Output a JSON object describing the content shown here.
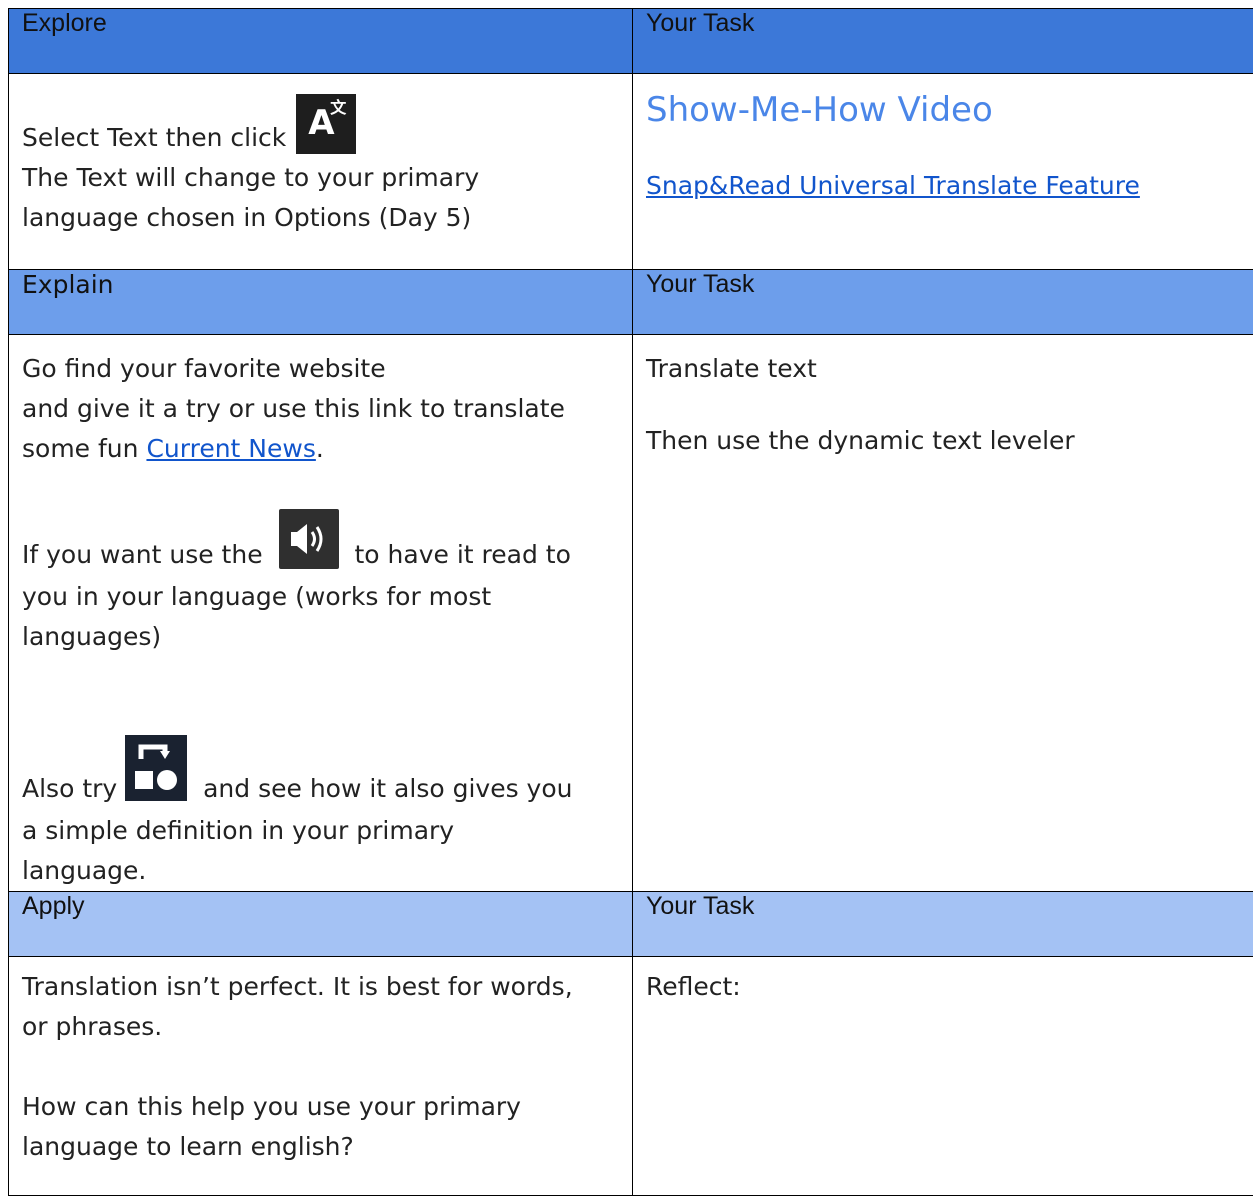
{
  "explore": {
    "header_left": "Explore",
    "header_right": "Your Task",
    "left_line1": "Select Text then click",
    "left_line2": "The Text will change to your primary",
    "left_line3": "language chosen in Options (Day 5)",
    "video_title": "Show-Me-How Video",
    "video_link": "Snap&Read Universal Translate Feature",
    "icon_name": "translate-icon"
  },
  "explain": {
    "header_left": "Explain",
    "header_right": "Your Task",
    "line1": "Go find your favorite website",
    "line2": "and give it a try or use this link to translate",
    "line3_prefix": "some fun ",
    "news_link": "Current News",
    "line3_suffix": ".",
    "speaker_prefix": "If you want use the",
    "speaker_suffix": "to have it read to",
    "line5": "you in your language (works for most",
    "line6": "languages)",
    "also_prefix": "Also try",
    "also_suffix": "and see how it also gives you",
    "line8": "a simple definition in your primary",
    "line9": "language.",
    "task1": "Translate text",
    "task2": "Then use the dynamic text leveler",
    "speaker_icon_name": "speaker-icon",
    "define_icon_name": "dictionary-icon"
  },
  "apply": {
    "header_left": "Apply",
    "header_right": "Your Task",
    "line1": "Translation isn’t perfect.  It is best for words,",
    "line2": "or phrases.",
    "line3": "How can this help you use your primary",
    "line4": "language to learn english?",
    "reflect": "Reflect:"
  },
  "colors": {
    "explore_header": "#3c78d8",
    "explain_header": "#6d9eeb",
    "apply_header": "#a4c2f4",
    "link": "#1155cc",
    "video_title": "#4a86e8"
  }
}
